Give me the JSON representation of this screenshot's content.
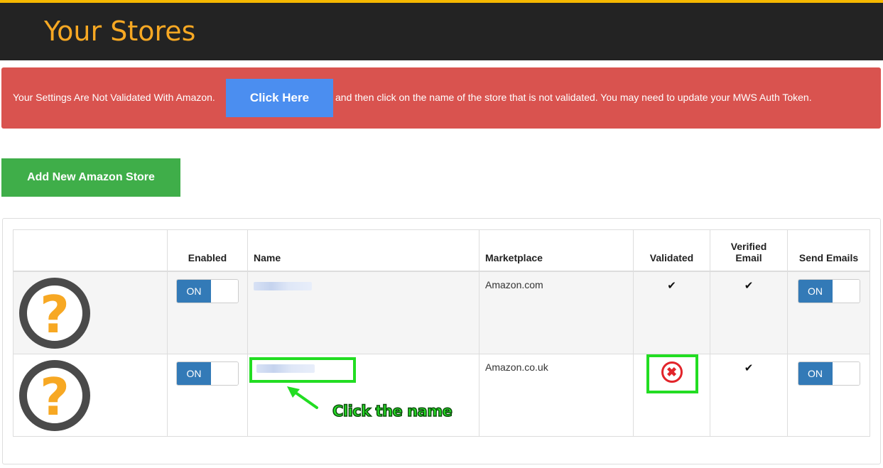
{
  "header": {
    "title": "Your Stores"
  },
  "alert": {
    "text_before": "Your Settings Are Not Validated With Amazon.",
    "button_label": "Click Here",
    "text_after": "and then click on the name of the store that is not validated. You may need to update your MWS Auth Token."
  },
  "toolbar": {
    "add_store_label": "Add New Amazon Store"
  },
  "table": {
    "columns": [
      "",
      "Enabled",
      "Name",
      "Marketplace",
      "Validated",
      "Verified Email",
      "Send Emails"
    ],
    "rows": [
      {
        "enabled": "ON",
        "marketplace": "Amazon.com",
        "validated": "✔",
        "verified_email": "✔",
        "send_emails": "ON"
      },
      {
        "enabled": "ON",
        "marketplace": "Amazon.co.uk",
        "validated": "✖",
        "verified_email": "✔",
        "send_emails": "ON"
      }
    ]
  },
  "icons": {
    "store": "question-mark-icon",
    "check": "checkmark-icon",
    "invalid": "x-circle-icon"
  },
  "colors": {
    "header_bg": "#232323",
    "title": "#f7a823",
    "alert_bg": "#d9534f",
    "click_button": "#4b8ef0",
    "add_button": "#3fae49",
    "toggle_on": "#337ab7",
    "highlight": "#22dd22"
  },
  "annotation": {
    "text": "Click the name"
  }
}
